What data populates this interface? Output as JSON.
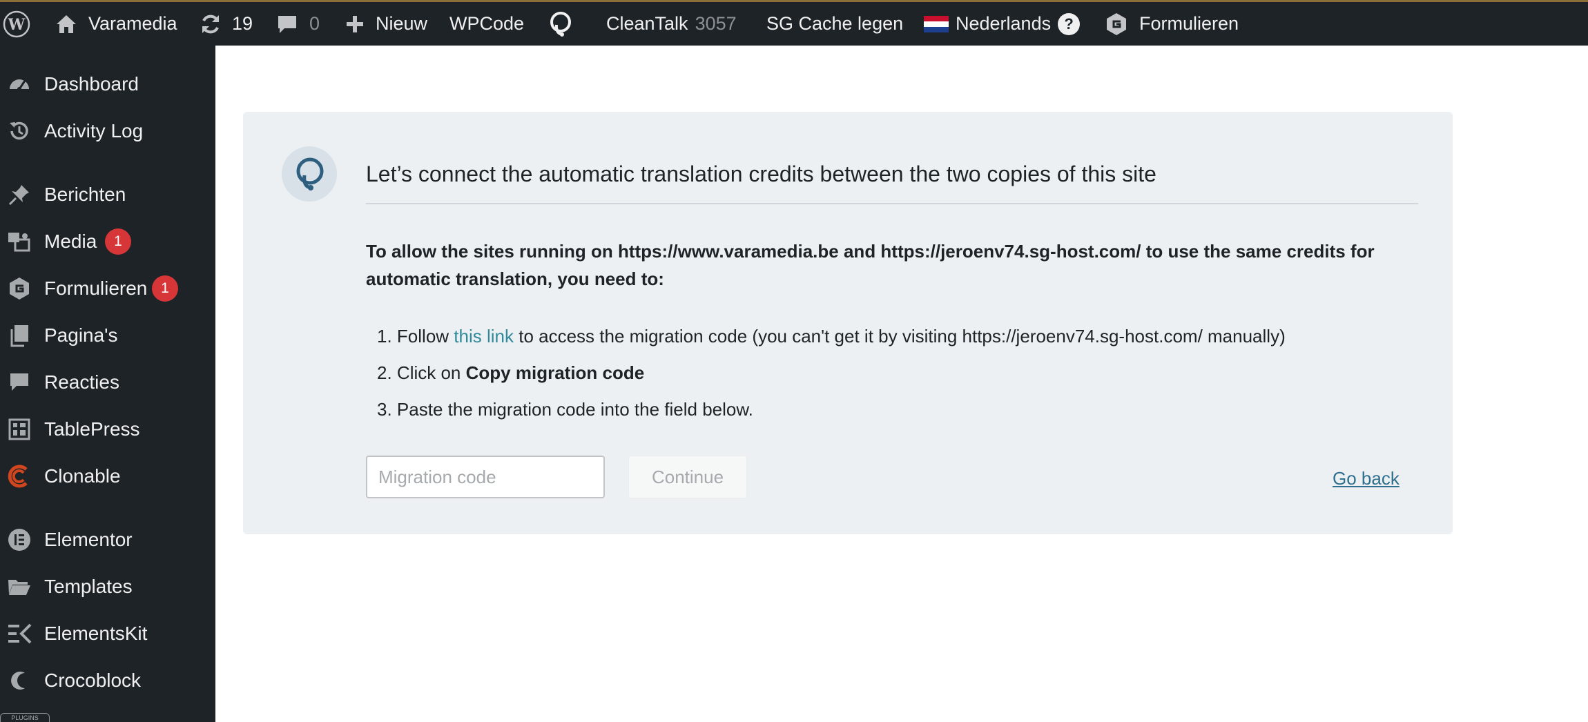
{
  "adminbar": {
    "site_name": "Varamedia",
    "updates_count": "19",
    "comments_count": "0",
    "new_label": "Nieuw",
    "wpcode_label": "WPCode",
    "cleantalk_label": "CleanTalk",
    "cleantalk_count": "3057",
    "sg_cache_label": "SG Cache legen",
    "language_label": "Nederlands",
    "help_glyph": "?",
    "forms_label": "Formulieren",
    "icons": [
      "wordpress-icon",
      "home-icon",
      "updates-icon",
      "comment-icon",
      "plus-icon",
      "wpml-icon",
      "flag-nl-icon",
      "help-icon",
      "gravity-forms-icon"
    ]
  },
  "sidebar": {
    "items": [
      {
        "label": "Dashboard",
        "icon": "dashboard-icon"
      },
      {
        "label": "Activity Log",
        "icon": "history-icon"
      },
      {
        "label": "Berichten",
        "icon": "pin-icon"
      },
      {
        "label": "Media",
        "icon": "media-icon",
        "badge": "1"
      },
      {
        "label": "Formulieren",
        "icon": "gravity-forms-icon",
        "badge": "1"
      },
      {
        "label": "Pagina's",
        "icon": "pages-icon"
      },
      {
        "label": "Reacties",
        "icon": "comment-icon"
      },
      {
        "label": "TablePress",
        "icon": "table-icon"
      },
      {
        "label": "Clonable",
        "icon": "clonable-icon"
      },
      {
        "label": "Elementor",
        "icon": "elementor-icon"
      },
      {
        "label": "Templates",
        "icon": "folder-icon"
      },
      {
        "label": "ElementsKit",
        "icon": "elementskit-icon"
      },
      {
        "label": "Crocoblock",
        "icon": "crocoblock-icon"
      }
    ],
    "bottom_tag": "PLUGINS"
  },
  "card": {
    "title": "Let’s connect the automatic translation credits between the two copies of this site",
    "intro": "To allow the sites running on https://www.varamedia.be and https://jeroenv74.sg-host.com/ to use the same credits for automatic translation, you need to:",
    "steps": [
      {
        "num": "1.",
        "before": "Follow",
        "link": "this link",
        "after": "to access the migration code (you can't get it by visiting https://jeroenv74.sg-host.com/ manually)"
      },
      {
        "num": "2.",
        "before": "Click on",
        "bold": "Copy migration code"
      },
      {
        "num": "3.",
        "text": "Paste the migration code into the field below."
      }
    ],
    "input_placeholder": "Migration code",
    "continue_label": "Continue",
    "go_back_label": "Go back"
  },
  "colors": {
    "adminbar_bg": "#1d2327",
    "card_bg": "#ecf0f3",
    "badge": "#d63638",
    "link": "#2f8a9b",
    "clonable_accent": "#d1461e"
  }
}
